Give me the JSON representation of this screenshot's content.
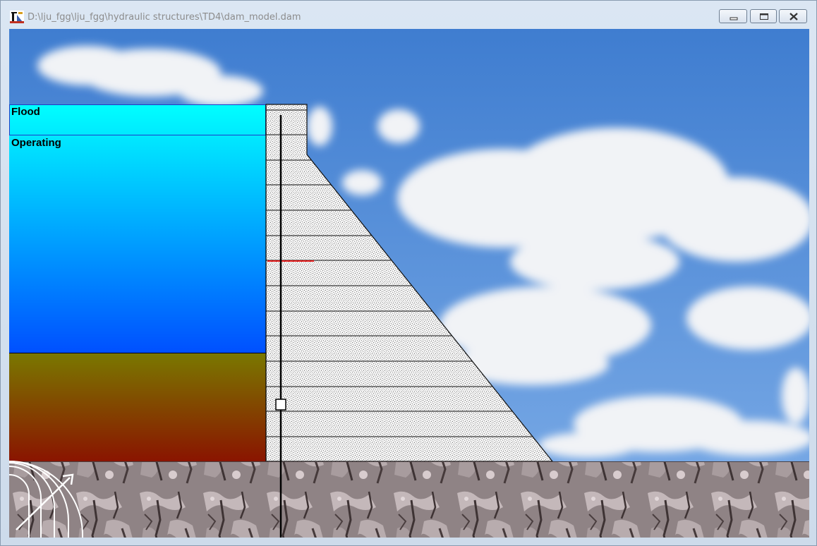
{
  "window": {
    "title": "D:\\lju_fgg\\lju_fgg\\hydraulic structures\\TD4\\dam_model.dam",
    "app_icon": "dam-app-icon",
    "controls": [
      "minimize-icon",
      "maximize-icon",
      "close-icon"
    ]
  },
  "reservoir": {
    "zones": [
      {
        "label": "Flood"
      },
      {
        "label": "Operating"
      }
    ],
    "sediment": {
      "label": ""
    }
  },
  "colors": {
    "sky": "#4f86d0",
    "water_top": "#00ffff",
    "water_bottom": "#0050ff",
    "sediment_top": "#7a7800",
    "sediment_bottom": "#8a1400",
    "zone_border": "#1e3cc8",
    "marker_line": "#e01818",
    "rock": "#8d8183"
  }
}
